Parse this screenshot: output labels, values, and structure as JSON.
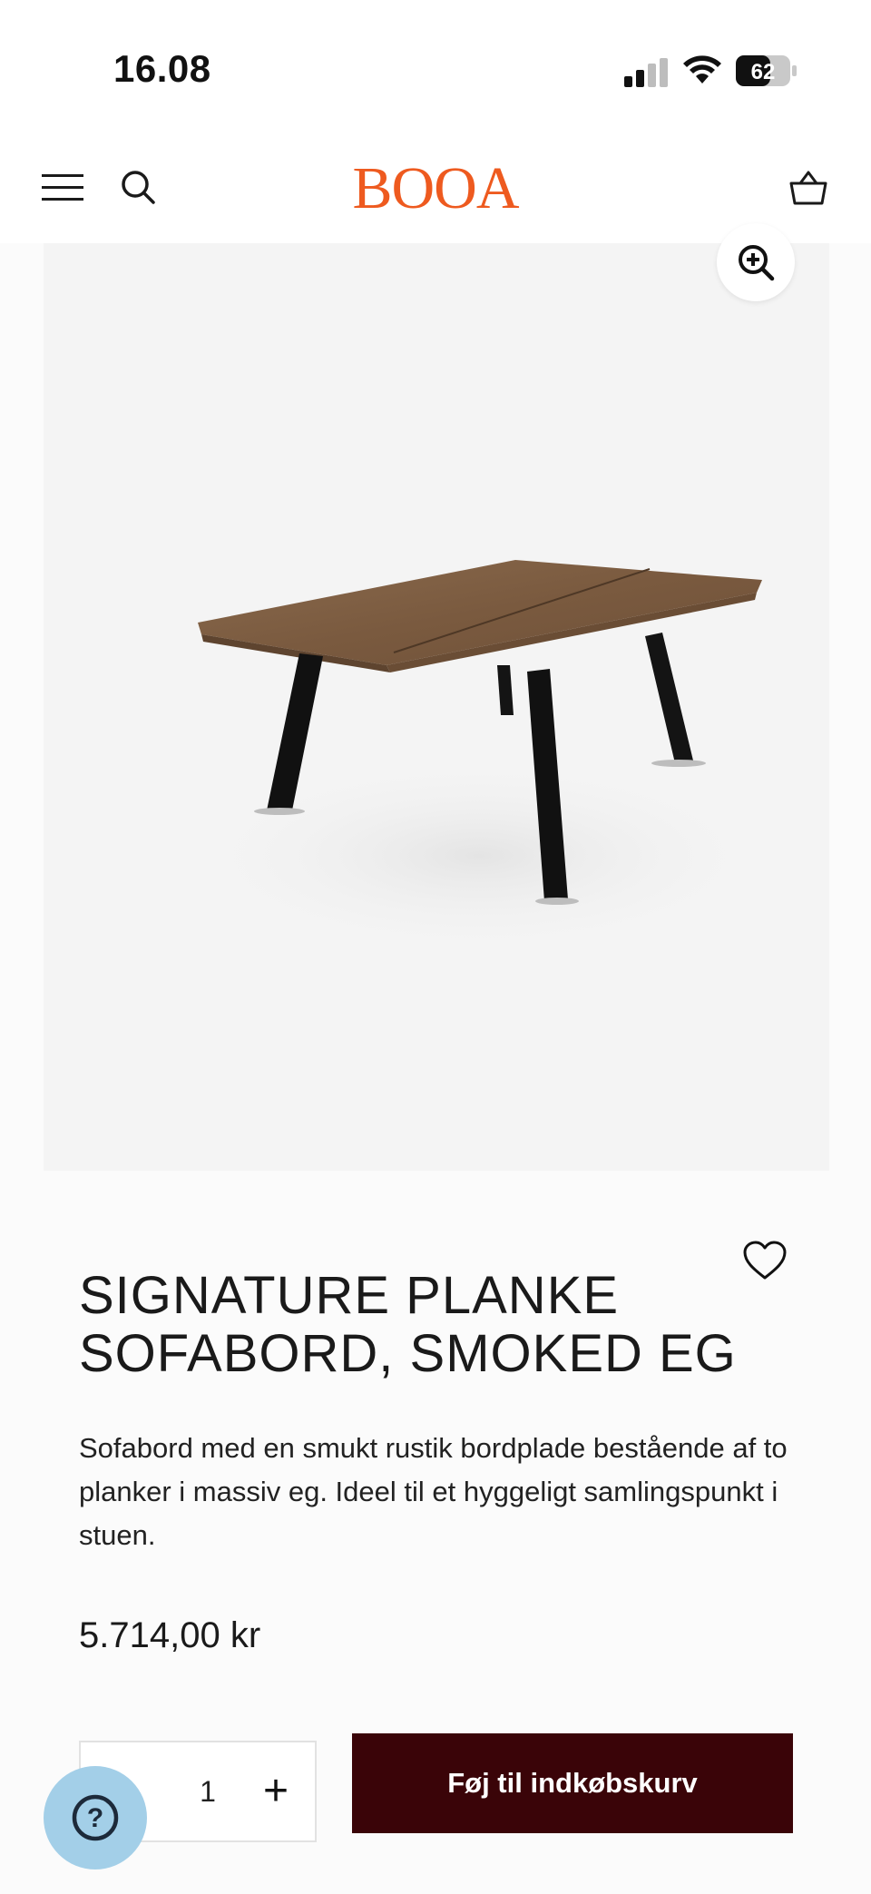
{
  "status_bar": {
    "time": "16.08",
    "battery": "62",
    "icons": [
      "signal-icon",
      "wifi-icon",
      "battery-icon"
    ]
  },
  "header": {
    "logo": "BOOA",
    "brand_color": "#ee5a1f",
    "icons": [
      "menu-icon",
      "search-icon",
      "basket-icon"
    ]
  },
  "gallery": {
    "zoom_icon": "zoom-in-icon"
  },
  "product": {
    "title_line1": "SIGNATURE PLANKE",
    "title_line2": "SOFABORD, SMOKED EG",
    "description": "Sofabord med en smukt rustik bordplade bestående af to planker i massiv eg. Ideel til et hyggeligt samlingspunkt i stuen.",
    "price": "5.714,00 kr",
    "wishlist_icon": "heart-icon"
  },
  "purchase": {
    "quantity": "1",
    "plus_label": "+",
    "add_to_cart_label": "Føj til indkøbskurv",
    "button_color": "#3a0408"
  },
  "help": {
    "label": "?",
    "color": "#a3cfe8"
  }
}
